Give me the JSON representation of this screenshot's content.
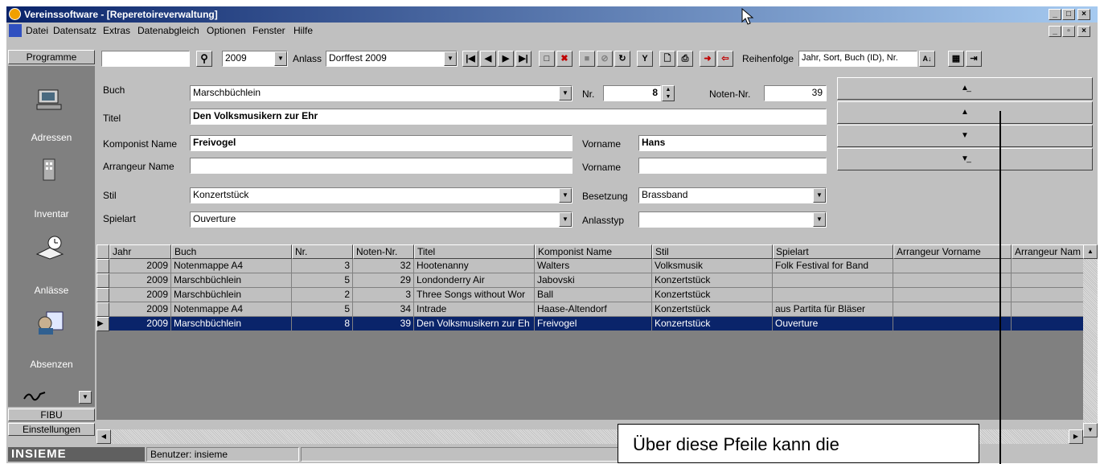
{
  "window": {
    "title": "Vereinssoftware - [Reperetoireverwaltung]"
  },
  "menu": [
    "Datei",
    "Datensatz",
    "Extras",
    "Datenabgleich",
    "Optionen",
    "Fenster",
    "Hilfe"
  ],
  "sidebar": {
    "header": "Programme",
    "items": [
      {
        "label": "Adressen",
        "icon": "computer-icon"
      },
      {
        "label": "Inventar",
        "icon": "building-icon"
      },
      {
        "label": "Anlässe",
        "icon": "calendar-book-icon"
      },
      {
        "label": "Absenzen",
        "icon": "person-list-icon"
      }
    ],
    "bottom": [
      "FIBU",
      "Einstellungen"
    ]
  },
  "toolbar": {
    "search_value": "",
    "year": "2009",
    "anlass_label": "Anlass",
    "anlass_value": "Dorffest 2009",
    "sort_label": "Reihenfolge",
    "sort_value": "Jahr, Sort, Buch (ID), Nr."
  },
  "form": {
    "buch_label": "Buch",
    "buch_value": "Marschbüchlein",
    "nr_label": "Nr.",
    "nr_value": "8",
    "noten_label": "Noten-Nr.",
    "noten_value": "39",
    "titel_label": "Titel",
    "titel_value": "Den Volksmusikern zur Ehr",
    "komponist_label": "Komponist Name",
    "komponist_value": "Freivogel",
    "vorname_label": "Vorname",
    "vorname_value": "Hans",
    "arrangeur_label": "Arrangeur Name",
    "arrangeur_value": "",
    "arr_vorname_label": "Vorname",
    "arr_vorname_value": "",
    "stil_label": "Stil",
    "stil_value": "Konzertstück",
    "besetzung_label": "Besetzung",
    "besetzung_value": "Brassband",
    "spielart_label": "Spielart",
    "spielart_value": "Ouverture",
    "anlasstyp_label": "Anlasstyp",
    "anlasstyp_value": ""
  },
  "grid": {
    "columns": [
      "Jahr",
      "Buch",
      "Nr.",
      "Noten-Nr.",
      "Titel",
      "Komponist Name",
      "Stil",
      "Spielart",
      "Arrangeur Vorname",
      "Arrangeur Nam"
    ],
    "rows": [
      [
        "2009",
        "Notenmappe A4",
        "3",
        "32",
        "Hootenanny",
        "Walters",
        "Volksmusik",
        "Folk Festival for Band",
        "",
        ""
      ],
      [
        "2009",
        "Marschbüchlein",
        "5",
        "29",
        "Londonderry Air",
        "Jabovski",
        "Konzertstück",
        "",
        "",
        ""
      ],
      [
        "2009",
        "Marschbüchlein",
        "2",
        "3",
        "Three Songs without Wor",
        "Ball",
        "Konzertstück",
        "",
        "",
        ""
      ],
      [
        "2009",
        "Notenmappe A4",
        "5",
        "34",
        "Intrade",
        "Haase-Altendorf",
        "Konzertstück",
        "aus Partita für Bläser",
        "",
        ""
      ],
      [
        "2009",
        "Marschbüchlein",
        "8",
        "39",
        "Den Volksmusikern zur Eh",
        "Freivogel",
        "Konzertstück",
        "Ouverture",
        "",
        ""
      ]
    ],
    "selected_row": 4
  },
  "status": {
    "logo": "INSIEME",
    "user": "Benutzer: insieme"
  },
  "callout": "Über diese Pfeile kann die"
}
